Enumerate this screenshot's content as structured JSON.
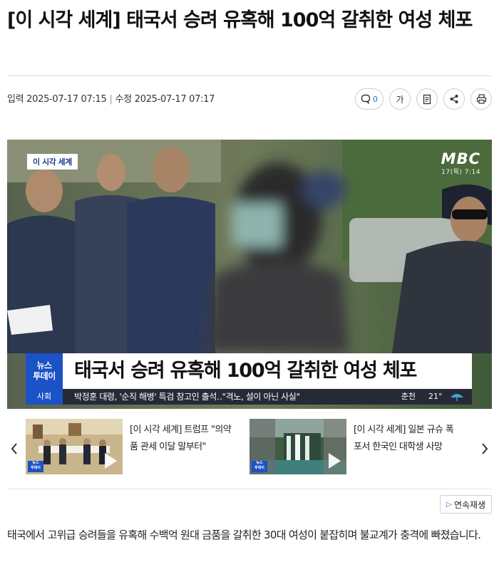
{
  "article": {
    "title": "[이 시각 세계] 태국서 승려 유혹해 100억 갈취한 여성 체포",
    "published": "입력 2025-07-17 07:15",
    "updated": "수정 2025-07-17 07:17",
    "comment_count": "0",
    "font_size_label": "가",
    "body": "태국에서 고위급 승려들을 유혹해 수백억 원대 금품을 갈취한 30대 여성이 붙잡히며 불교계가 충격에 빠졌습니다."
  },
  "toolbar": {
    "icons": [
      "comment-icon",
      "font-size-icon",
      "bookmark-icon",
      "share-icon",
      "print-icon"
    ]
  },
  "video": {
    "corner_tag": "이 시각 세계",
    "brand_logo": "MBC",
    "brand_time": "17(목) 7:14",
    "badge_line1": "뉴스",
    "badge_line2": "투데이",
    "caption": "태국서 승려 유혹해 100억 갈취한 여성 체포",
    "ticker_section": "사회",
    "ticker_text": "박정훈 대령, '순직 해병' 특검 참고인 출석‥\"격노, 설이 아닌 사실\"",
    "ticker_city": "춘천",
    "ticker_temp": "21°",
    "accent_color": "#1b52c5"
  },
  "related": [
    {
      "title": "[이 시각 세계] 트럼프 \"의약품 관세 이달 말부터\""
    },
    {
      "title": "[이 시각 세계] 일본 규슈 폭포서 한국인 대학생 사망"
    }
  ],
  "autoplay_label": "연속재생"
}
